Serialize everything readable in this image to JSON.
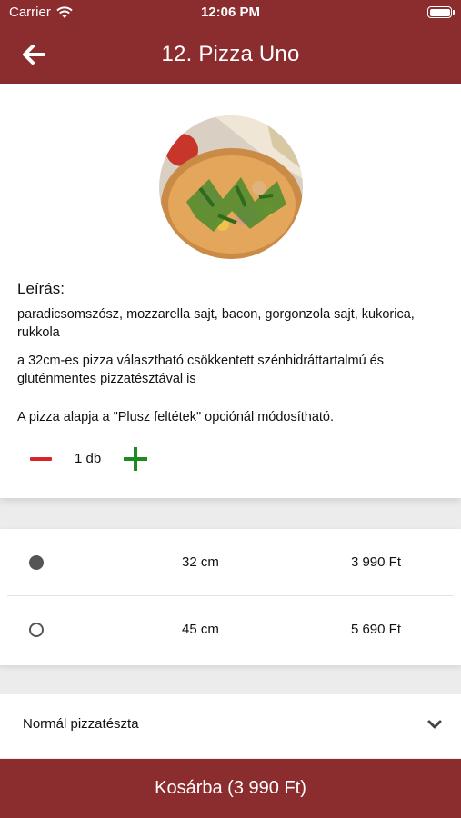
{
  "status_bar": {
    "carrier": "Carrier",
    "time": "12:06 PM"
  },
  "header": {
    "title": "12. Pizza Uno",
    "back_icon": "arrow-left-icon"
  },
  "product": {
    "image": "pizza-photo",
    "description_label": "Leírás:",
    "ingredients": "paradicsomszósz, mozzarella sajt, bacon, gorgonzola sajt, kukorica, rukkola",
    "note_dough": "a 32cm-es pizza választható csökkentett szénhidráttartalmú és gluténmentes pizzatésztával is",
    "note_toppings": "A pizza alapja a  \"Plusz feltétek\" opciónál módosítható."
  },
  "quantity": {
    "value": "1 db"
  },
  "sizes": [
    {
      "label": "32 cm",
      "price": "3 990 Ft",
      "selected": true
    },
    {
      "label": "45 cm",
      "price": "5 690 Ft",
      "selected": false
    }
  ],
  "dough": {
    "selected": "Normál pizzatészta",
    "icon": "chevron-down-icon"
  },
  "cart": {
    "label": "Kosárba (3 990 Ft)"
  },
  "colors": {
    "brand": "#8b2c2f",
    "minus": "#d8232a",
    "plus": "#1f8a1f"
  }
}
